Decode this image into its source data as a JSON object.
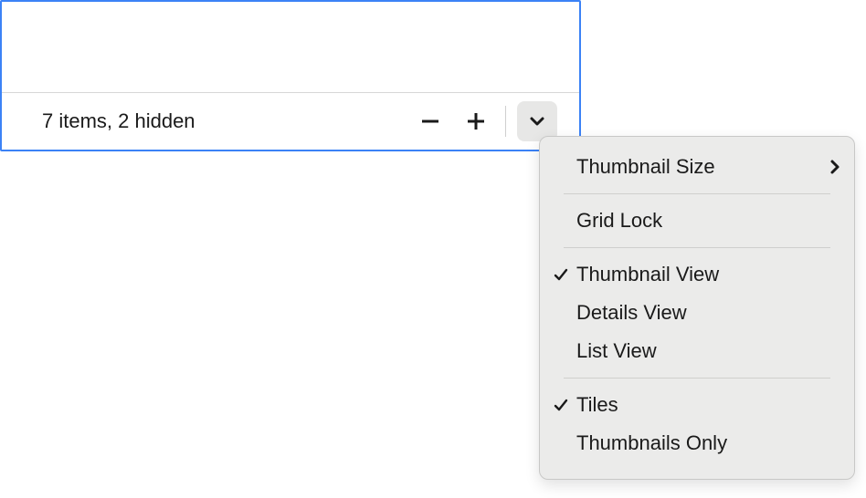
{
  "status": {
    "text": "7 items, 2 hidden"
  },
  "menu": {
    "thumbnail_size": "Thumbnail Size",
    "grid_lock": "Grid Lock",
    "thumbnail_view": "Thumbnail View",
    "details_view": "Details View",
    "list_view": "List View",
    "tiles": "Tiles",
    "thumbnails_only": "Thumbnails Only"
  }
}
